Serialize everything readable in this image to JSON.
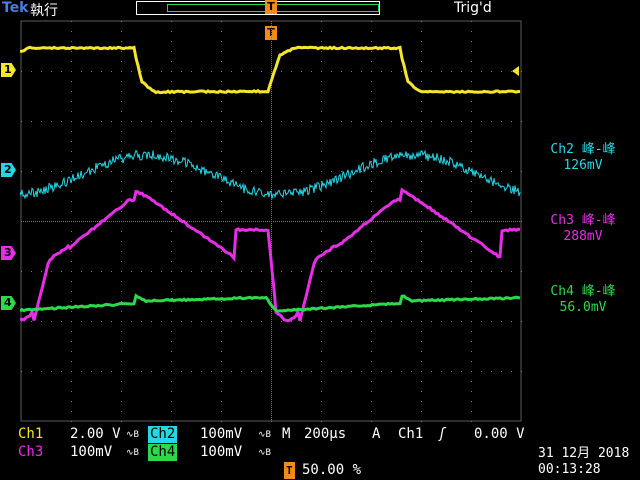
{
  "header": {
    "brand": "Tek",
    "run_state": "執行",
    "trigger_position_label": "T",
    "trigger_status": "Trig'd"
  },
  "channels": {
    "ch1": {
      "marker": "1",
      "color": "#f5e62c"
    },
    "ch2": {
      "marker": "2",
      "color": "#25d6e6"
    },
    "ch3": {
      "marker": "3",
      "color": "#e62ee6"
    },
    "ch4": {
      "marker": "4",
      "color": "#2bd94a"
    }
  },
  "measurements": [
    {
      "label": "Ch2 峰-峰",
      "value": "126mV",
      "color": "#25d6e6"
    },
    {
      "label": "Ch3 峰-峰",
      "value": "288mV",
      "color": "#e62ee6"
    },
    {
      "label": "Ch4 峰-峰",
      "value": "56.0mV",
      "color": "#2bd94a"
    }
  ],
  "status": {
    "ch1_label": "Ch1",
    "ch1_scale": "2.00 V",
    "ch2_label": "Ch2",
    "ch2_scale": "100mV",
    "ch3_label": "Ch3",
    "ch3_scale": "100mV",
    "ch4_label": "Ch4",
    "ch4_scale": "100mV",
    "coupling_symbol": "∿B",
    "horizontal_prefix": "M",
    "timebase": "200µs",
    "trigger_mode": "A",
    "trigger_source": "Ch1",
    "trigger_slope": "ʃ",
    "trigger_level": "0.00 V",
    "trigger_pos_icon": "T",
    "trigger_position": "50.00 %",
    "date": "31 12月 2018",
    "time": "00:13:28"
  }
}
